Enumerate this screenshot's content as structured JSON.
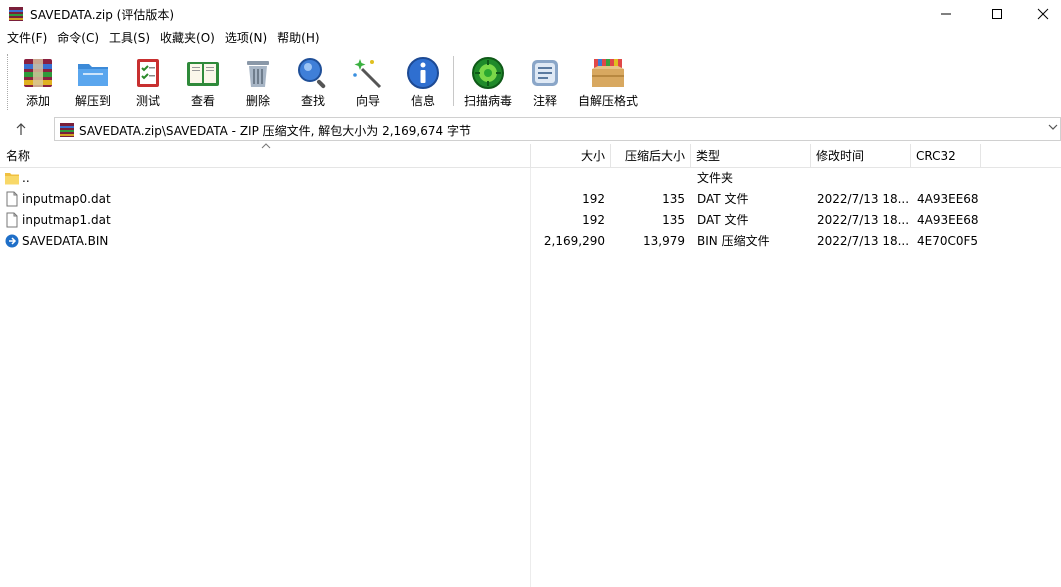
{
  "window": {
    "title": "SAVEDATA.zip (评估版本)"
  },
  "menu": [
    "文件(F)",
    "命令(C)",
    "工具(S)",
    "收藏夹(O)",
    "选项(N)",
    "帮助(H)"
  ],
  "toolbar": {
    "buttons": [
      {
        "label": "添加",
        "icon": "add-archive-icon"
      },
      {
        "label": "解压到",
        "icon": "extract-to-folder-icon"
      },
      {
        "label": "测试",
        "icon": "test-checklist-icon"
      },
      {
        "label": "查看",
        "icon": "view-book-icon"
      },
      {
        "label": "删除",
        "icon": "delete-trash-icon"
      },
      {
        "label": "查找",
        "icon": "find-magnifier-icon"
      },
      {
        "label": "向导",
        "icon": "wizard-wand-icon"
      },
      {
        "label": "信息",
        "icon": "info-icon"
      },
      {
        "label": "扫描病毒",
        "icon": "virus-scan-icon"
      },
      {
        "label": "注释",
        "icon": "comment-icon"
      },
      {
        "label": "自解压格式",
        "icon": "sfx-boxes-icon"
      }
    ]
  },
  "address": {
    "path": "SAVEDATA.zip\\SAVEDATA - ZIP 压缩文件, 解包大小为 2,169,674 字节"
  },
  "columns": {
    "name": "名称",
    "size": "大小",
    "packed": "压缩后大小",
    "type": "类型",
    "modified": "修改时间",
    "crc": "CRC32"
  },
  "files": [
    {
      "name": "..",
      "size": "",
      "packed": "",
      "type": "文件夹",
      "modified": "",
      "crc": "",
      "icon": "folder-up-icon"
    },
    {
      "name": "inputmap0.dat",
      "size": "192",
      "packed": "135",
      "type": "DAT 文件",
      "modified": "2022/7/13 18...",
      "crc": "4A93EE68",
      "icon": "file-icon"
    },
    {
      "name": "inputmap1.dat",
      "size": "192",
      "packed": "135",
      "type": "DAT 文件",
      "modified": "2022/7/13 18...",
      "crc": "4A93EE68",
      "icon": "file-icon"
    },
    {
      "name": "SAVEDATA.BIN",
      "size": "2,169,290",
      "packed": "13,979",
      "type": "BIN 压缩文件",
      "modified": "2022/7/13 18...",
      "crc": "4E70C0F5",
      "icon": "bin-file-icon"
    }
  ]
}
